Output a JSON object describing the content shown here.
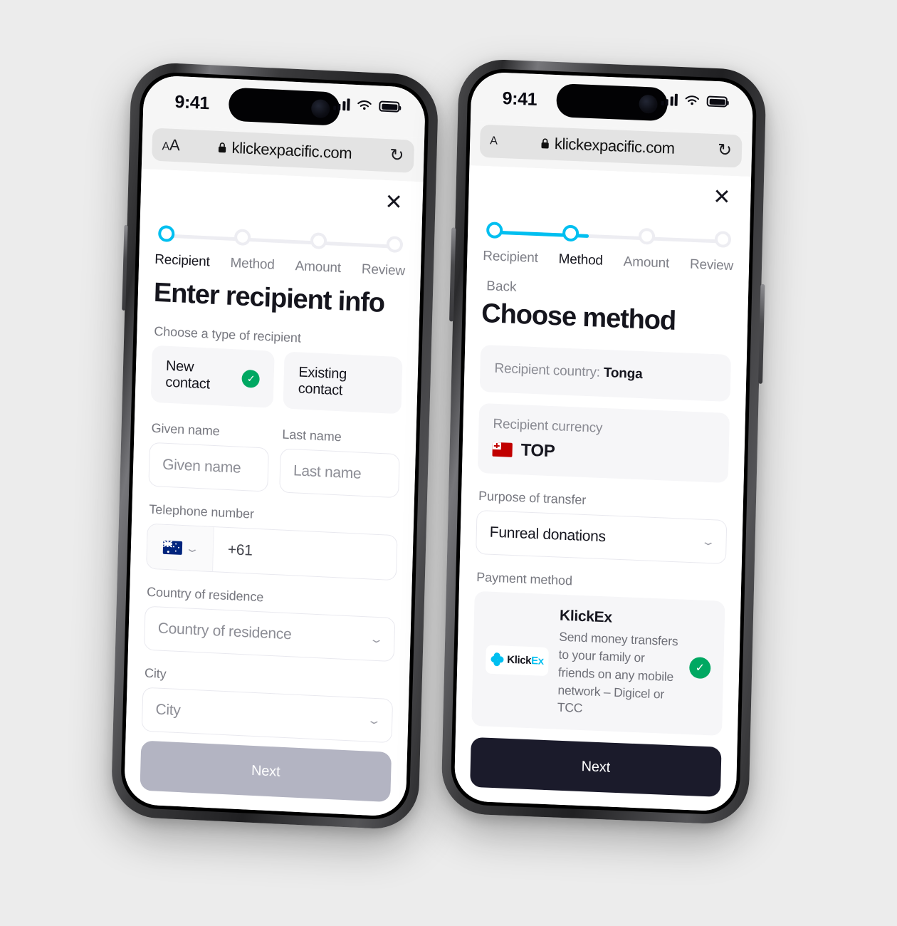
{
  "colors": {
    "accent_cyan": "#00bff0",
    "accent_green": "#00a862",
    "button_disabled": "#b3b4c2",
    "button_active": "#1b1b2b",
    "page_background": "#ececec",
    "panel_grey": "#f6f6f8"
  },
  "phones": [
    {
      "id": "recipient-screen",
      "status_bar": {
        "time": "9:41",
        "signal_icon": "cellular-bars-icon",
        "wifi_icon": "wifi-icon",
        "battery_icon": "battery-icon"
      },
      "browser": {
        "text_size_label": "AA",
        "lock_icon": "lock-icon",
        "url": "klickexpacific.com",
        "reload_icon": "reload-icon"
      },
      "close_icon": "close-icon",
      "stepper": {
        "steps": [
          {
            "label": "Recipient",
            "state": "active"
          },
          {
            "label": "Method",
            "state": "inactive"
          },
          {
            "label": "Amount",
            "state": "inactive"
          },
          {
            "label": "Review",
            "state": "inactive"
          }
        ],
        "progress_percent": 0
      },
      "title": "Enter recipient info",
      "recipient_type": {
        "label": "Choose a type of recipient",
        "options": [
          {
            "label": "New contact",
            "selected": true,
            "check_icon": "check-circle-icon"
          },
          {
            "label": "Existing contact",
            "selected": false
          }
        ]
      },
      "fields": [
        {
          "label": "Given name",
          "placeholder": "Given name",
          "value": "",
          "type": "text"
        },
        {
          "label": "Last name",
          "placeholder": "Last name",
          "value": "",
          "type": "text"
        }
      ],
      "telephone": {
        "label": "Telephone number",
        "country_flag": "australia-flag-icon",
        "chevron_icon": "chevron-down-icon",
        "prefix": "+61",
        "value": ""
      },
      "country_of_residence": {
        "label": "Country of residence",
        "placeholder": "Country of residence",
        "value": "",
        "chevron_icon": "chevron-down-icon"
      },
      "city": {
        "label": "City",
        "placeholder": "City",
        "value": "",
        "chevron_icon": "chevron-down-icon"
      },
      "next_button": {
        "label": "Next",
        "state": "disabled"
      }
    },
    {
      "id": "method-screen",
      "status_bar": {
        "time": "9:41",
        "signal_icon": "cellular-bars-icon",
        "wifi_icon": "wifi-icon",
        "battery_icon": "battery-icon"
      },
      "browser": {
        "text_size_label": "A",
        "lock_icon": "lock-icon",
        "url": "klickexpacific.com",
        "reload_icon": "reload-icon"
      },
      "close_icon": "close-icon",
      "stepper": {
        "steps": [
          {
            "label": "Recipient",
            "state": "done"
          },
          {
            "label": "Method",
            "state": "active"
          },
          {
            "label": "Amount",
            "state": "inactive"
          },
          {
            "label": "Review",
            "state": "inactive"
          }
        ],
        "progress_percent": 33
      },
      "back_label": "Back",
      "title": "Choose method",
      "recipient_country": {
        "label": "Recipient country: ",
        "value": "Tonga"
      },
      "recipient_currency": {
        "label": "Recipient currency",
        "flag_icon": "tonga-flag-icon",
        "code": "TOP"
      },
      "purpose_of_transfer": {
        "label": "Purpose of transfer",
        "value": "Funreal donations",
        "chevron_icon": "chevron-down-icon"
      },
      "payment_method": {
        "label": "Payment method",
        "options": [
          {
            "logo_icon": "klickex-logo-icon",
            "logo_text_dark": "Klick",
            "logo_text_accent": "Ex",
            "name": "KlickEx",
            "description": "Send money transfers to your family or friends on any mobile network – Digicel or TCC",
            "selected": true,
            "check_icon": "check-circle-icon"
          }
        ]
      },
      "next_button": {
        "label": "Next",
        "state": "active"
      }
    }
  ]
}
